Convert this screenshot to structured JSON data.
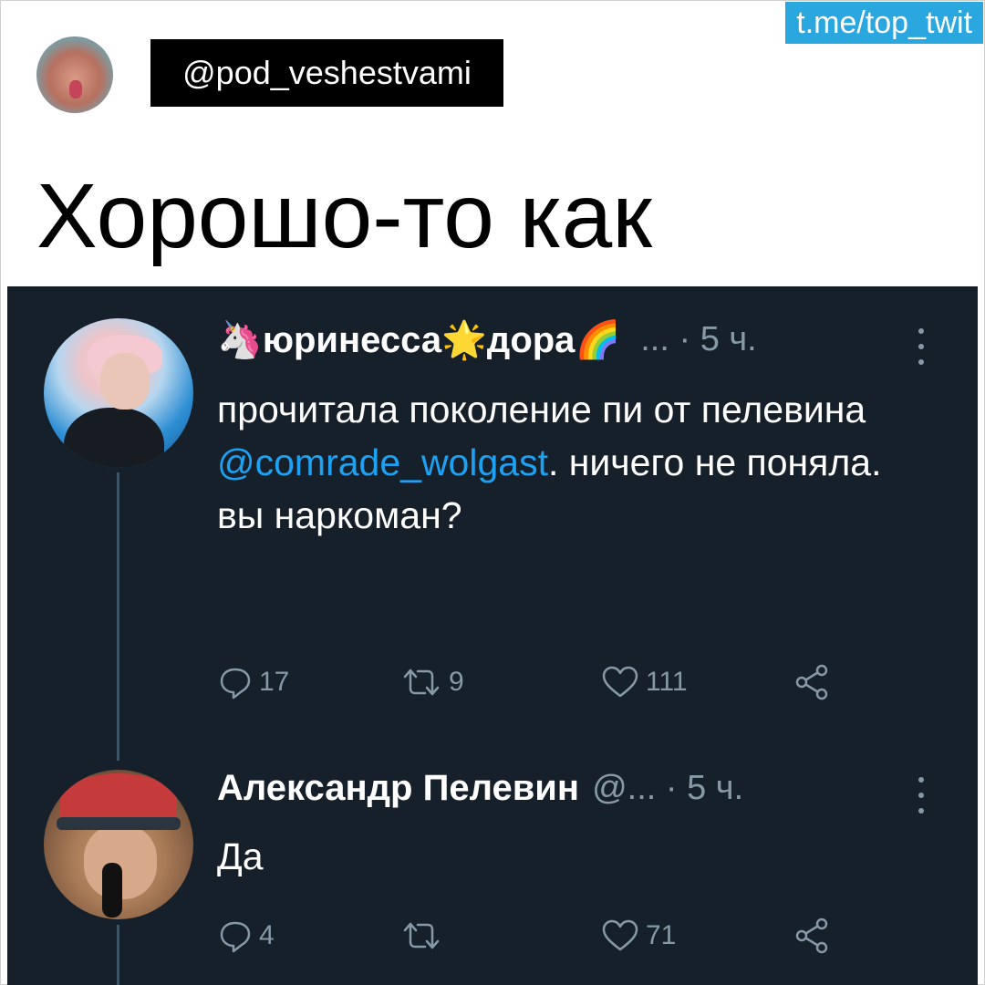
{
  "watermark": "t.me/top_twit",
  "poster": {
    "handle": "@pod_veshestvami",
    "avatar_icon": "poster-avatar"
  },
  "headline": "Хорошо-то как",
  "colors": {
    "dark_bg": "#15202b",
    "muted": "#8899a6",
    "mention": "#1da1f2",
    "watermark_bg": "#29a7de"
  },
  "tweets": [
    {
      "avatar_icon": "pink-haired-person-avatar",
      "name_prefix_emoji": "🦄",
      "name_part1": "юринесса",
      "name_mid_emoji": "🌟",
      "name_part2": "дора",
      "name_suffix_emoji": "🌈",
      "meta": "... · 5 ч.",
      "text_before_mention": "прочитала поколение пи от пелевина ",
      "mention": "@comrade_wolgast",
      "text_after_mention": ". ничего не поняла. вы наркоман?",
      "replies": "17",
      "retweets": "9",
      "likes": "111"
    },
    {
      "avatar_icon": "man-in-red-cap-avatar",
      "name": "Александр Пелевин",
      "meta": "@... · 5 ч.",
      "text": "Да",
      "replies": "4",
      "retweets": "",
      "likes": "71"
    }
  ]
}
